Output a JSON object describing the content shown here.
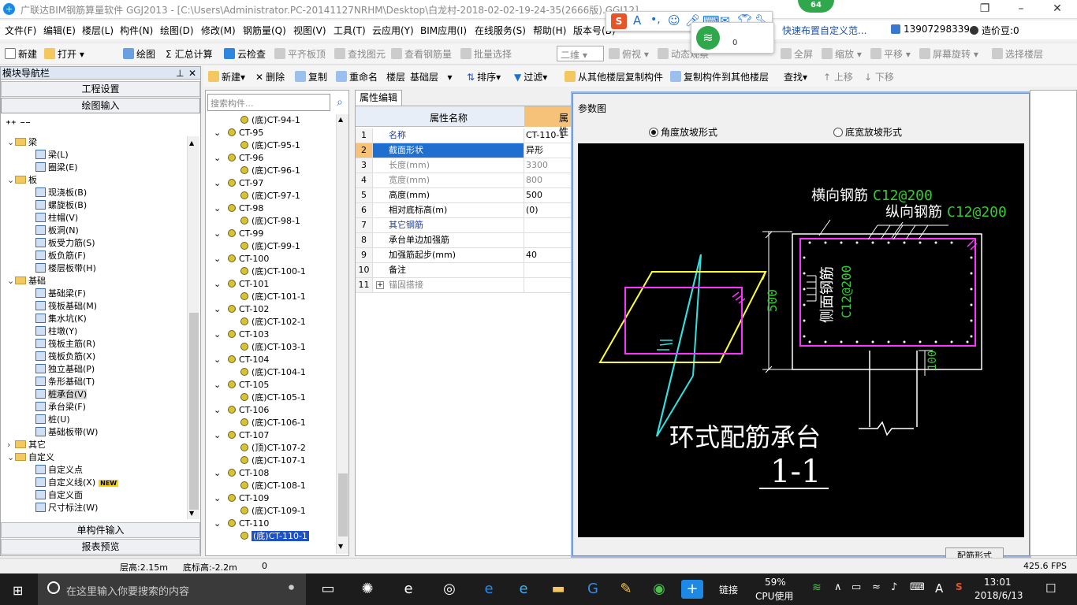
{
  "window": {
    "title": "广联达BIM钢筋算量软件 GGJ2013 - [C:\\Users\\Administrator.PC-20141127NRHM\\Desktop\\白龙村-2018-02-02-19-24-35(2666版).GGJ12]"
  },
  "menu": [
    "文件(F)",
    "编辑(E)",
    "楼层(L)",
    "构件(N)",
    "绘图(D)",
    "修改(M)",
    "钢筋量(Q)",
    "视图(V)",
    "工具(T)",
    "云应用(Y)",
    "BIM应用(I)",
    "在线服务(S)",
    "帮助(H)",
    "版本号(B)"
  ],
  "menu_right": {
    "quick": "快速布置自定义范...",
    "phone": "13907298339",
    "price": "造价豆:0"
  },
  "toolbar1": [
    "新建",
    "打开",
    "绘图",
    "汇总计算",
    "云检查",
    "平齐板顶",
    "查找图元",
    "查看钢筋量",
    "批量选择",
    "二维",
    "俯视",
    "动态观察",
    "全屏",
    "缩放",
    "平移",
    "屏幕旋转",
    "选择楼层"
  ],
  "toolbar2": {
    "new": "新建",
    "delete": "删除",
    "copy": "复制",
    "rename": "重命名",
    "floor_label": "楼层",
    "floor_value": "基础层",
    "sort": "排序",
    "filter": "过滤",
    "copy_from": "从其他楼层复制构件",
    "copy_to": "复制构件到其他楼层",
    "find": "查找",
    "up": "上移",
    "down": "下移"
  },
  "panel": {
    "title": "模块导航栏",
    "btn_project": "工程设置",
    "btn_draw": "绘图输入",
    "btn_single": "单构件输入",
    "btn_report": "报表预览"
  },
  "tree": [
    {
      "label": "梁",
      "type": "folder",
      "level": 0
    },
    {
      "label": "梁(L)",
      "level": 1
    },
    {
      "label": "圈梁(E)",
      "level": 1
    },
    {
      "label": "板",
      "type": "folder",
      "level": 0
    },
    {
      "label": "现浇板(B)",
      "level": 1
    },
    {
      "label": "螺旋板(B)",
      "level": 1
    },
    {
      "label": "柱帽(V)",
      "level": 1
    },
    {
      "label": "板洞(N)",
      "level": 1
    },
    {
      "label": "板受力筋(S)",
      "level": 1
    },
    {
      "label": "板负筋(F)",
      "level": 1
    },
    {
      "label": "楼层板带(H)",
      "level": 1
    },
    {
      "label": "基础",
      "type": "folder",
      "level": 0
    },
    {
      "label": "基础梁(F)",
      "level": 1
    },
    {
      "label": "筏板基础(M)",
      "level": 1
    },
    {
      "label": "集水坑(K)",
      "level": 1
    },
    {
      "label": "柱墩(Y)",
      "level": 1
    },
    {
      "label": "筏板主筋(R)",
      "level": 1
    },
    {
      "label": "筏板负筋(X)",
      "level": 1
    },
    {
      "label": "独立基础(P)",
      "level": 1
    },
    {
      "label": "条形基础(T)",
      "level": 1
    },
    {
      "label": "桩承台(V)",
      "level": 1,
      "selected": true
    },
    {
      "label": "承台梁(F)",
      "level": 1
    },
    {
      "label": "桩(U)",
      "level": 1
    },
    {
      "label": "基础板带(W)",
      "level": 1
    },
    {
      "label": "其它",
      "type": "folder",
      "level": 0,
      "collapsed": true
    },
    {
      "label": "自定义",
      "type": "folder",
      "level": 0
    },
    {
      "label": "自定义点",
      "level": 1
    },
    {
      "label": "自定义线(X)",
      "level": 1,
      "badge": "NEW"
    },
    {
      "label": "自定义面",
      "level": 1
    },
    {
      "label": "尺寸标注(W)",
      "level": 1
    }
  ],
  "components": {
    "search_placeholder": "搜索构件...",
    "items": [
      {
        "label": "(底)CT-94-1",
        "child": true
      },
      {
        "label": "CT-95"
      },
      {
        "label": "(底)CT-95-1",
        "child": true
      },
      {
        "label": "CT-96"
      },
      {
        "label": "(底)CT-96-1",
        "child": true
      },
      {
        "label": "CT-97"
      },
      {
        "label": "(底)CT-97-1",
        "child": true
      },
      {
        "label": "CT-98"
      },
      {
        "label": "(底)CT-98-1",
        "child": true
      },
      {
        "label": "CT-99"
      },
      {
        "label": "(底)CT-99-1",
        "child": true
      },
      {
        "label": "CT-100"
      },
      {
        "label": "(底)CT-100-1",
        "child": true
      },
      {
        "label": "CT-101"
      },
      {
        "label": "(底)CT-101-1",
        "child": true
      },
      {
        "label": "CT-102"
      },
      {
        "label": "(底)CT-102-1",
        "child": true
      },
      {
        "label": "CT-103"
      },
      {
        "label": "(底)CT-103-1",
        "child": true
      },
      {
        "label": "CT-104"
      },
      {
        "label": "(底)CT-104-1",
        "child": true
      },
      {
        "label": "CT-105"
      },
      {
        "label": "(底)CT-105-1",
        "child": true
      },
      {
        "label": "CT-106"
      },
      {
        "label": "(底)CT-106-1",
        "child": true
      },
      {
        "label": "CT-107"
      },
      {
        "label": "(顶)CT-107-2",
        "child": true
      },
      {
        "label": "(底)CT-107-1",
        "child": true
      },
      {
        "label": "CT-108"
      },
      {
        "label": "(底)CT-108-1",
        "child": true
      },
      {
        "label": "CT-109"
      },
      {
        "label": "(底)CT-109-1",
        "child": true
      },
      {
        "label": "CT-110"
      },
      {
        "label": "(底)CT-110-1",
        "child": true,
        "selected": true
      }
    ]
  },
  "props": {
    "tab": "属性编辑",
    "col_name": "属性名称",
    "col_value": "属性",
    "rows": [
      {
        "n": "1",
        "k": "名称",
        "v": "CT-110-1",
        "style": "blue"
      },
      {
        "n": "2",
        "k": "截面形状",
        "v": "异形",
        "style": "selected"
      },
      {
        "n": "3",
        "k": "长度(mm)",
        "v": "3300",
        "style": "gray"
      },
      {
        "n": "4",
        "k": "宽度(mm)",
        "v": "800",
        "style": "gray"
      },
      {
        "n": "5",
        "k": "高度(mm)",
        "v": "500"
      },
      {
        "n": "6",
        "k": "相对底标高(m)",
        "v": "(0)"
      },
      {
        "n": "7",
        "k": "其它钢筋",
        "v": "",
        "style": "blue"
      },
      {
        "n": "8",
        "k": "承台单边加强筋",
        "v": ""
      },
      {
        "n": "9",
        "k": "加强筋起步(mm)",
        "v": "40"
      },
      {
        "n": "10",
        "k": "备注",
        "v": ""
      },
      {
        "n": "11",
        "k": "锚固搭接",
        "v": "",
        "style": "gray",
        "expand": "+"
      }
    ]
  },
  "param": {
    "title": "参数图",
    "opt_angle": "角度放坡形式",
    "opt_width": "底宽放坡形式",
    "h_rebar_label": "横向钢筋",
    "h_rebar_value": "C12@200",
    "v_rebar_label": "纵向钢筋",
    "v_rebar_value": "C12@200",
    "side_label": "侧面钢筋",
    "side_value": "C12@200",
    "dim_height": "500",
    "dim_100": "100",
    "caption": "环式配筋承台",
    "section": "1-1",
    "btn": "配筋形式"
  },
  "status": {
    "floor_h": "层高:2.15m",
    "base_h": "底标高:-2.2m",
    "zero": "0",
    "fps": "425.6 FPS"
  },
  "taskbar": {
    "search": "在这里输入你要搜索的内容",
    "link": "链接",
    "cpu_pct": "59%",
    "cpu_label": "CPU使用",
    "time": "13:01",
    "date": "2018/6/13",
    "ime_lang": "A",
    "green_badge": "64",
    "wifi_count": "0"
  },
  "colors": {
    "accent": "#1e50c8",
    "canvas": "#000000",
    "magenta": "#ff33ff",
    "yellow": "#ffff33",
    "cyan": "#33e0e0",
    "green": "#33cc33"
  }
}
